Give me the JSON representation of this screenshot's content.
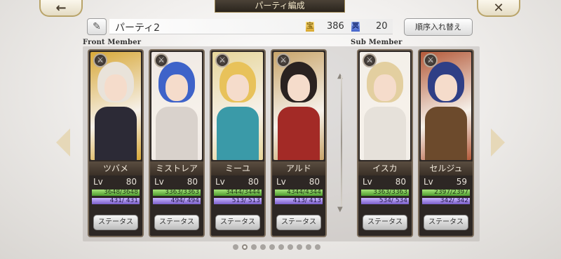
{
  "nav": {
    "back_icon": "←",
    "close_icon": "✕",
    "title": "パーティ編成"
  },
  "header": {
    "edit_icon": "✎",
    "party_name": "パーティ2",
    "cost_icon": "宝",
    "cost_value": "386",
    "soul_icon": "冥",
    "soul_value": "20",
    "reorder_label": "順序入れ替え"
  },
  "sections": {
    "front_label": "Front Member",
    "sub_label": "Sub Member"
  },
  "members": [
    {
      "name": "ツバメ",
      "lv_label": "Lv",
      "lv": "80",
      "hp": "3648/3648",
      "mp": "431/ 431",
      "status_label": "ステータス",
      "colors": {
        "hair": "#e9e3da",
        "bg": "#d8a838",
        "body": "#2c2a36"
      }
    },
    {
      "name": "ミストレア",
      "lv_label": "Lv",
      "lv": "80",
      "hp": "3363/3363",
      "mp": "494/ 494",
      "status_label": "ステータス",
      "colors": {
        "hair": "#3e63c9",
        "bg": "#efe8e4",
        "body": "#d9d2cc"
      }
    },
    {
      "name": "ミーユ",
      "lv_label": "Lv",
      "lv": "80",
      "hp": "3444/3444",
      "mp": "513/ 513",
      "status_label": "ステータス",
      "colors": {
        "hair": "#e8c25a",
        "bg": "#e7d69a",
        "body": "#3a9aa8"
      }
    },
    {
      "name": "アルド",
      "lv_label": "Lv",
      "lv": "80",
      "hp": "4344/4344",
      "mp": "413/ 413",
      "status_label": "ステータス",
      "colors": {
        "hair": "#2a2220",
        "bg": "#c9a56b",
        "body": "#a32a26"
      }
    },
    {
      "name": "イスカ",
      "lv_label": "Lv",
      "lv": "80",
      "hp": "3363/3363",
      "mp": "534/ 534",
      "status_label": "ステータス",
      "colors": {
        "hair": "#e3cfa0",
        "bg": "#f3efe9",
        "body": "#e6e1da"
      }
    },
    {
      "name": "セルジュ",
      "lv_label": "Lv",
      "lv": "59",
      "hp": "2397/2397",
      "mp": "342/ 342",
      "status_label": "ステータス",
      "colors": {
        "hair": "#2f3f86",
        "bg": "#b45a3a",
        "body": "#6c4a2c"
      }
    }
  ],
  "pagination": {
    "total": 10,
    "active": 2
  }
}
